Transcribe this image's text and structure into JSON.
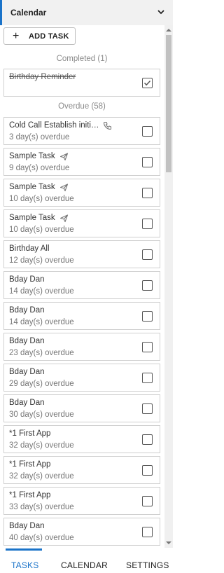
{
  "header": {
    "title": "Calendar"
  },
  "toolbar": {
    "add_task_plus": "+",
    "add_task_label": "ADD TASK"
  },
  "sections": {
    "completed": "Completed (1)",
    "overdue": "Overdue (58)"
  },
  "completed_tasks": [
    {
      "title": "Birthday Reminder",
      "checked": true
    }
  ],
  "overdue_tasks": [
    {
      "title": "Cold Call Establish initi…",
      "subtitle": "3 day(s) overdue",
      "icon": "phone-icon"
    },
    {
      "title": "Sample Task",
      "subtitle": "9 day(s) overdue",
      "icon": "send-icon"
    },
    {
      "title": "Sample Task",
      "subtitle": "10 day(s) overdue",
      "icon": "send-icon"
    },
    {
      "title": "Sample Task",
      "subtitle": "10 day(s) overdue",
      "icon": "send-icon"
    },
    {
      "title": "Birthday All",
      "subtitle": "12 day(s) overdue",
      "icon": ""
    },
    {
      "title": "Bday Dan",
      "subtitle": "14 day(s) overdue",
      "icon": ""
    },
    {
      "title": "Bday Dan",
      "subtitle": "14 day(s) overdue",
      "icon": ""
    },
    {
      "title": "Bday Dan",
      "subtitle": "23 day(s) overdue",
      "icon": ""
    },
    {
      "title": "Bday Dan",
      "subtitle": "29 day(s) overdue",
      "icon": ""
    },
    {
      "title": "Bday Dan",
      "subtitle": "30 day(s) overdue",
      "icon": ""
    },
    {
      "title": "*1 First App",
      "subtitle": "32 day(s) overdue",
      "icon": ""
    },
    {
      "title": "*1 First App",
      "subtitle": "32 day(s) overdue",
      "icon": ""
    },
    {
      "title": "*1 First App",
      "subtitle": "33 day(s) overdue",
      "icon": ""
    },
    {
      "title": "Bday Dan",
      "subtitle": "40 day(s) overdue",
      "icon": ""
    }
  ],
  "tabs": [
    {
      "label": "TASKS",
      "active": true
    },
    {
      "label": "CALENDAR",
      "active": false
    },
    {
      "label": "SETTINGS",
      "active": false
    }
  ],
  "colors": {
    "accent": "#1a73c9",
    "card_border": "#cfcfcf",
    "muted_text": "#8a8a8a"
  }
}
